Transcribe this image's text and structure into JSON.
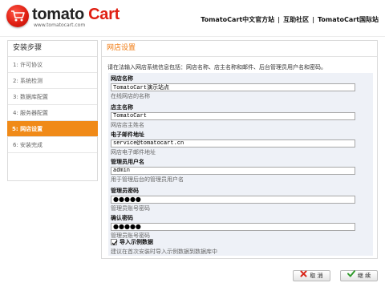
{
  "header": {
    "logo_word1": "tomato",
    "logo_word2": "Cart",
    "logo_url": "www.tomatocart.com",
    "links": [
      "TomatoCart中文官方站",
      "互助社区",
      "TomatoCart国际站"
    ],
    "separator": "|"
  },
  "sidebar": {
    "title": "安装步骤",
    "steps": [
      "1: 许可协议",
      "2: 系统检测",
      "3: 数据库配置",
      "4: 服务器配置",
      "5: 网店设置",
      "6: 安装完成"
    ],
    "active_index": 4
  },
  "panel": {
    "title": "网店设置",
    "intro": "请在法输入网店系统信息包括：网店名称、店主名称和邮件、后台管理员用户名和密码。",
    "fields": [
      {
        "label": "网店名称",
        "value": "TomatoCart演示站点",
        "help": "在线网店的名称"
      },
      {
        "label": "店主名称",
        "value": "TomatoCart",
        "help": "网店店主姓名"
      },
      {
        "label": "电子邮件地址",
        "value": "service@tomatocart.cn",
        "help": "网店电子邮件地址"
      },
      {
        "label": "管理员用户名",
        "value": "admin",
        "help": "用于管理后台的管理员用户名"
      },
      {
        "label": "管理员密码",
        "value": "●●●●●",
        "help": "管理员账号密码"
      },
      {
        "label": "确认密码",
        "value": "●●●●●",
        "help": "管理员账号密码"
      }
    ],
    "sample_checked": true,
    "sample_label": "导入示例数据",
    "sample_help": "建议在首次安装时导入示例数据到数据库中"
  },
  "buttons": {
    "cancel": "取 消",
    "continue": "继 续"
  },
  "colors": {
    "accent_orange": "#f08a18",
    "brand_red": "#e01f12",
    "form_background": "#eef1f7"
  },
  "icons": [
    "tomato-logo-icon",
    "cancel-x-icon",
    "continue-check-icon",
    "checkbox-check-icon"
  ]
}
